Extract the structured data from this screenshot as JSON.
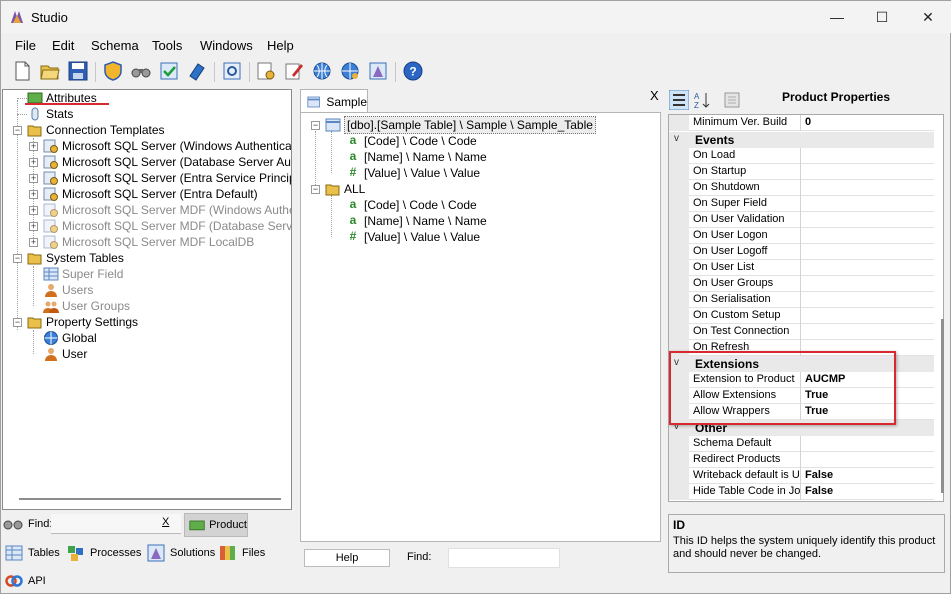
{
  "window": {
    "title": "Studio",
    "minimize": "—",
    "maximize": "☐",
    "close": "✕"
  },
  "menu": [
    "File",
    "Edit",
    "Schema",
    "Tools",
    "Windows",
    "Help"
  ],
  "tree": {
    "attributes": "Attributes",
    "stats": "Stats",
    "connection_templates": "Connection Templates",
    "connections": [
      "Microsoft SQL Server (Windows Authentication)",
      "Microsoft SQL Server (Database Server Authent",
      "Microsoft SQL Server (Entra Service Principal)",
      "Microsoft SQL Server (Entra Default)",
      "Microsoft SQL Server MDF (Windows Authentic",
      "Microsoft SQL Server MDF (Database Server Au",
      "Microsoft SQL Server MDF LocalDB"
    ],
    "system_tables": "System Tables",
    "system_items": [
      "Super Field",
      "Users",
      "User Groups"
    ],
    "property_settings": "Property Settings",
    "property_items": [
      "Global",
      "User"
    ]
  },
  "left_bottom": {
    "find_label": "Find:",
    "clear": "X",
    "product": "Product",
    "tables": "Tables",
    "processes": "Processes",
    "solutions": "Solutions",
    "files": "Files",
    "api": "API"
  },
  "middle": {
    "tab": "Sample",
    "close": "X",
    "root": "[dbo].[Sample Table] \\ Sample \\ Sample_Table",
    "root_fields": [
      {
        "type": "a",
        "text": "[Code] \\ Code \\ Code"
      },
      {
        "type": "a",
        "text": "[Name] \\ Name \\ Name"
      },
      {
        "type": "#",
        "text": "[Value] \\ Value \\ Value"
      }
    ],
    "all": "ALL",
    "all_fields": [
      {
        "type": "a",
        "text": "[Code] \\ Code \\ Code"
      },
      {
        "type": "a",
        "text": "[Name] \\ Name \\ Name"
      },
      {
        "type": "#",
        "text": "[Value] \\ Value \\ Value"
      }
    ],
    "help": "Help",
    "find": "Find:"
  },
  "properties": {
    "title": "Product Properties",
    "top_row": {
      "name": "Minimum Ver. Build",
      "value": "0"
    },
    "events_label": "Events",
    "events": [
      "On Load",
      "On Startup",
      "On Shutdown",
      "On Super Field",
      "On User Validation",
      "On User Logon",
      "On User Logoff",
      "On User List",
      "On User Groups",
      "On Serialisation",
      "On Custom Setup",
      "On Test Connection",
      "On Refresh"
    ],
    "extensions_label": "Extensions",
    "extensions": [
      {
        "name": "Extension to Product",
        "value": "AUCMP"
      },
      {
        "name": "Allow Extensions",
        "value": "True"
      },
      {
        "name": "Allow Wrappers",
        "value": "True"
      }
    ],
    "other_label": "Other",
    "other": [
      {
        "name": "Schema Default",
        "value": ""
      },
      {
        "name": "Redirect Products",
        "value": ""
      },
      {
        "name": "Writeback default is Up",
        "value": "False"
      },
      {
        "name": "Hide Table Code in Joi",
        "value": "False"
      }
    ],
    "desc_title": "ID",
    "desc_text": "This ID helps the system uniquely identify this product and should never be changed."
  },
  "colors": {
    "accent": "#d9282f",
    "folder": "#e8c04a"
  }
}
